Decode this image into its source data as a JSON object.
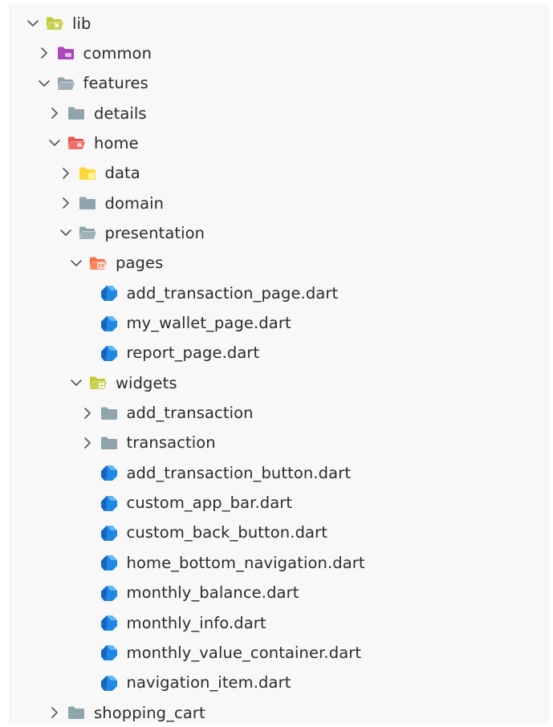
{
  "colors": {
    "folder_gray": "#90a4ae",
    "folder_lib": "#c0ca33",
    "folder_common": "#ab47bc",
    "folder_home": "#ef5350",
    "folder_data": "#fdd835",
    "folder_pages": "#ff7043",
    "folder_widgets": "#c0ca33",
    "dart_blue": "#1e88e5",
    "chevron": "#555555"
  },
  "tree": [
    {
      "label": "lib",
      "depth": 0,
      "expanded": true,
      "kind": "folder",
      "icon": "folder-lib-icon"
    },
    {
      "label": "common",
      "depth": 1,
      "expanded": false,
      "kind": "folder",
      "icon": "folder-common-icon"
    },
    {
      "label": "features",
      "depth": 1,
      "expanded": true,
      "kind": "folder",
      "icon": "folder-open-icon"
    },
    {
      "label": "details",
      "depth": 2,
      "expanded": false,
      "kind": "folder",
      "icon": "folder-icon"
    },
    {
      "label": "home",
      "depth": 2,
      "expanded": true,
      "kind": "folder",
      "icon": "folder-home-icon"
    },
    {
      "label": "data",
      "depth": 3,
      "expanded": false,
      "kind": "folder",
      "icon": "folder-data-icon"
    },
    {
      "label": "domain",
      "depth": 3,
      "expanded": false,
      "kind": "folder",
      "icon": "folder-icon"
    },
    {
      "label": "presentation",
      "depth": 3,
      "expanded": true,
      "kind": "folder",
      "icon": "folder-open-icon"
    },
    {
      "label": "pages",
      "depth": 4,
      "expanded": true,
      "kind": "folder",
      "icon": "folder-pages-icon"
    },
    {
      "label": "add_transaction_page.dart",
      "depth": 5,
      "kind": "file",
      "icon": "dart-file-icon"
    },
    {
      "label": "my_wallet_page.dart",
      "depth": 5,
      "kind": "file",
      "icon": "dart-file-icon"
    },
    {
      "label": "report_page.dart",
      "depth": 5,
      "kind": "file",
      "icon": "dart-file-icon"
    },
    {
      "label": "widgets",
      "depth": 4,
      "expanded": true,
      "kind": "folder",
      "icon": "folder-widgets-icon"
    },
    {
      "label": "add_transaction",
      "depth": 5,
      "expanded": false,
      "kind": "folder",
      "icon": "folder-icon"
    },
    {
      "label": "transaction",
      "depth": 5,
      "expanded": false,
      "kind": "folder",
      "icon": "folder-icon"
    },
    {
      "label": "add_transaction_button.dart",
      "depth": 5,
      "kind": "file",
      "icon": "dart-file-icon"
    },
    {
      "label": "custom_app_bar.dart",
      "depth": 5,
      "kind": "file",
      "icon": "dart-file-icon"
    },
    {
      "label": "custom_back_button.dart",
      "depth": 5,
      "kind": "file",
      "icon": "dart-file-icon"
    },
    {
      "label": "home_bottom_navigation.dart",
      "depth": 5,
      "kind": "file",
      "icon": "dart-file-icon"
    },
    {
      "label": "monthly_balance.dart",
      "depth": 5,
      "kind": "file",
      "icon": "dart-file-icon"
    },
    {
      "label": "monthly_info.dart",
      "depth": 5,
      "kind": "file",
      "icon": "dart-file-icon"
    },
    {
      "label": "monthly_value_container.dart",
      "depth": 5,
      "kind": "file",
      "icon": "dart-file-icon"
    },
    {
      "label": "navigation_item.dart",
      "depth": 5,
      "kind": "file",
      "icon": "dart-file-icon"
    },
    {
      "label": "shopping_cart",
      "depth": 2,
      "expanded": false,
      "kind": "folder",
      "icon": "folder-icon"
    }
  ]
}
